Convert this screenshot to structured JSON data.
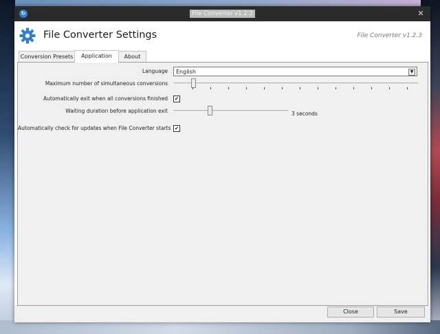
{
  "window": {
    "title": "File Converter v1.2.3"
  },
  "header": {
    "title": "File Converter Settings",
    "version": "File Converter v1.2.3"
  },
  "tabs": [
    {
      "label": "Conversion Presets",
      "active": false
    },
    {
      "label": "Application",
      "active": true
    },
    {
      "label": "About",
      "active": false
    }
  ],
  "application": {
    "language_label": "Language",
    "language_value": "English",
    "max_conversions_label": "Maximum number of simultaneous conversions",
    "auto_exit_label": "Automatically exit when all conversions finished",
    "auto_exit_checked": true,
    "auto_exit_check_glyph": "✔",
    "waiting_label": "Waiting duration before application exit",
    "waiting_value_text": "3 seconds",
    "update_check_label": "Automatically check for updates when File Converter starts",
    "update_check_checked": true,
    "update_check_glyph": "✔"
  },
  "buttons": {
    "close": "Close",
    "save": "Save"
  },
  "colors": {
    "accent": "#2d7fd2",
    "titlebar": "#2b2b2b"
  }
}
